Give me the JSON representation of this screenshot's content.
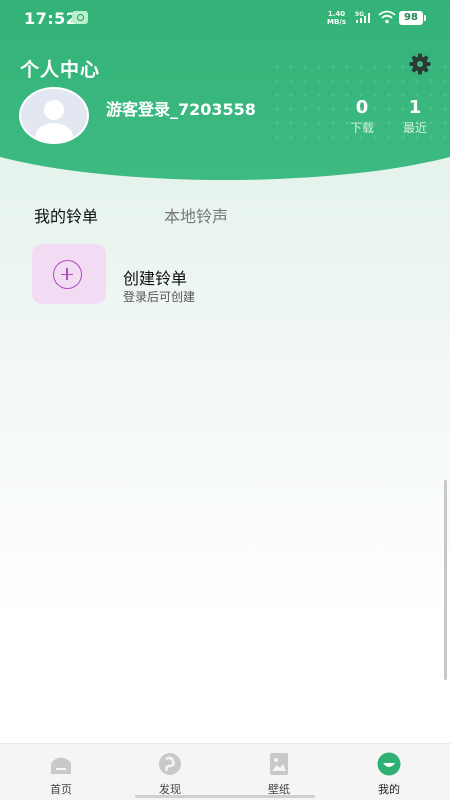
{
  "status_bar": {
    "time": "17:52",
    "net_speed_value": "1.40",
    "net_speed_unit": "MB/s",
    "signal": "5G",
    "battery": "98"
  },
  "header": {
    "title": "个人中心",
    "username": "游客登录_7203558",
    "stats": [
      {
        "value": "0",
        "label": "下载"
      },
      {
        "value": "1",
        "label": "最近"
      }
    ]
  },
  "tabs": [
    {
      "label": "我的铃单",
      "active": true
    },
    {
      "label": "本地铃声",
      "active": false
    }
  ],
  "create_playlist": {
    "title": "创建铃单",
    "subtitle": "登录后可创建"
  },
  "bottom_nav": [
    {
      "label": "首页",
      "icon": "home-icon",
      "active": false
    },
    {
      "label": "发现",
      "icon": "discover-icon",
      "active": false
    },
    {
      "label": "壁纸",
      "icon": "wallpaper-icon",
      "active": false
    },
    {
      "label": "我的",
      "icon": "profile-icon",
      "active": true
    }
  ],
  "colors": {
    "primary": "#2fb075",
    "accent_purple": "#b04cc4",
    "card_bg": "#f1dcf4"
  }
}
